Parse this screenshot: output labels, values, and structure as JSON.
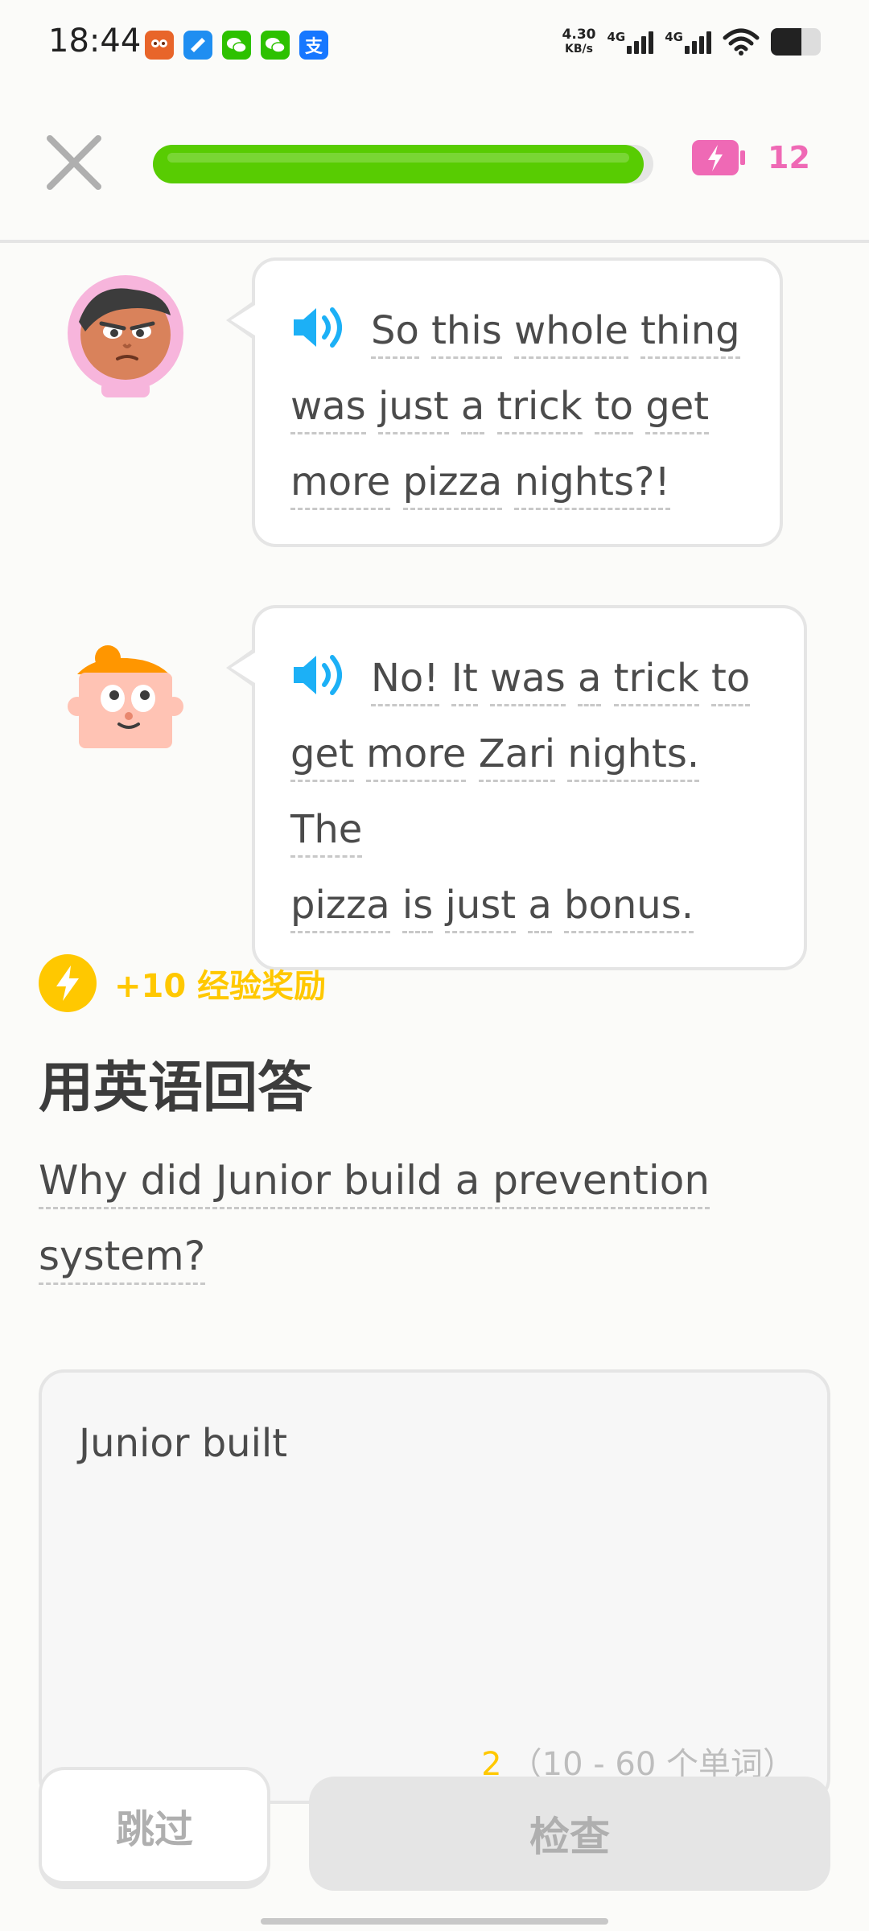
{
  "status_bar": {
    "time": "18:44",
    "net_speed_value": "4.30",
    "net_speed_unit": "KB/s",
    "signal_1": "4G",
    "signal_2": "4G",
    "battery_level_percent": 62,
    "app_icons": [
      "taobao-app-icon",
      "browser-app-icon",
      "wechat-app-icon",
      "wechat-app-icon",
      "alipay-app-icon"
    ],
    "alipay_glyph": "支"
  },
  "lesson": {
    "progress_percent": 98,
    "energy_count": "12"
  },
  "chat": {
    "messages": [
      {
        "speaker": "junior",
        "words_line1": [
          "So",
          "this",
          "whole",
          "thing"
        ],
        "words_line2": [
          "was",
          "just",
          "a",
          "trick",
          "to",
          "get"
        ],
        "words_line3": [
          "more",
          "pizza",
          "nights?!"
        ]
      },
      {
        "speaker": "zari",
        "words_line1": [
          "No!",
          "It",
          "was",
          "a",
          "trick",
          "to"
        ],
        "words_line2": [
          "get",
          "more",
          "Zari",
          "nights.",
          "The"
        ],
        "words_line3": [
          "pizza",
          "is",
          "just",
          "a",
          "bonus."
        ]
      }
    ]
  },
  "xp": {
    "label": "+10 经验奖励"
  },
  "prompt": {
    "title": "用英语回答",
    "question_line1": "Why did Junior build a prevention",
    "question_line2": "system?"
  },
  "answer": {
    "value": "Junior built",
    "word_count": "2",
    "word_range": "（10 - 60 个单词）"
  },
  "buttons": {
    "skip": "跳过",
    "check": "检查"
  },
  "colors": {
    "progress": "#58cc02",
    "energy": "#ef69b5",
    "xp": "#ffc800",
    "speaker": "#1cb0f6"
  }
}
